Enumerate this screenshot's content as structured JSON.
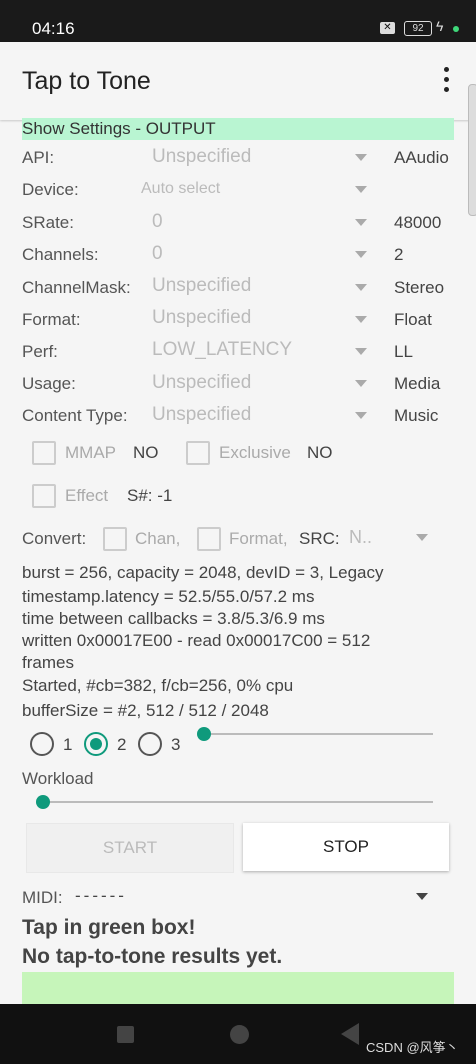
{
  "status_bar": {
    "time": "04:16",
    "battery": "92",
    "close_glyph": "✕",
    "bolt_glyph": "ϟ"
  },
  "app_bar": {
    "title": "Tap to Tone"
  },
  "settings_toggle": "Show Settings - OUTPUT",
  "rows": [
    {
      "label": "API:",
      "value": "Unspecified",
      "actual": "AAudio"
    },
    {
      "label": "Device:",
      "value": "Auto select",
      "actual": ""
    },
    {
      "label": "SRate:",
      "value": "0",
      "actual": "48000"
    },
    {
      "label": "Channels:",
      "value": "0",
      "actual": "2"
    },
    {
      "label": "ChannelMask:",
      "value": "Unspecified",
      "actual": "Stereo"
    },
    {
      "label": "Format:",
      "value": "Unspecified",
      "actual": "Float"
    },
    {
      "label": "Perf:",
      "value": "LOW_LATENCY",
      "actual": "LL"
    },
    {
      "label": "Usage:",
      "value": "Unspecified",
      "actual": "Media"
    },
    {
      "label": "Content Type:",
      "value": "Unspecified",
      "actual": "Music"
    }
  ],
  "options": {
    "mmap_label": "MMAP",
    "mmap_value": "NO",
    "exclusive_label": "Exclusive",
    "exclusive_value": "NO",
    "effect_label": "Effect",
    "session": "S#: -1"
  },
  "convert": {
    "label": "Convert:",
    "chan": "Chan,",
    "format": "Format,",
    "src_label": "SRC:",
    "src_value": "N.."
  },
  "stats": [
    "burst = 256, capacity = 2048, devID = 3, Legacy",
    "timestamp.latency = 52.5/55.0/57.2 ms",
    "time between callbacks = 3.8/5.3/6.9 ms",
    "written 0x00017E00 - read 0x00017C00 = 512",
    "frames",
    "Started, #cb=382, f/cb=256,  0% cpu",
    "bufferSize = #2, 512 / 512 / 2048"
  ],
  "buffer": {
    "options": [
      "1",
      "2",
      "3"
    ],
    "selected": "2",
    "slider_fraction": 0.0
  },
  "workload": {
    "label": "Workload",
    "fraction": 0.0
  },
  "buttons": {
    "start": "START",
    "stop": "STOP"
  },
  "midi": {
    "label": "MIDI:",
    "value": "------"
  },
  "messages": {
    "line1": "Tap in green box!",
    "line2": "No tap-to-tone results yet."
  },
  "watermark": "CSDN @风筝丶",
  "colors": {
    "accent": "#0f9a7c",
    "settings_bg": "#b9f5d2",
    "tap_box": "#c6f5ba"
  }
}
